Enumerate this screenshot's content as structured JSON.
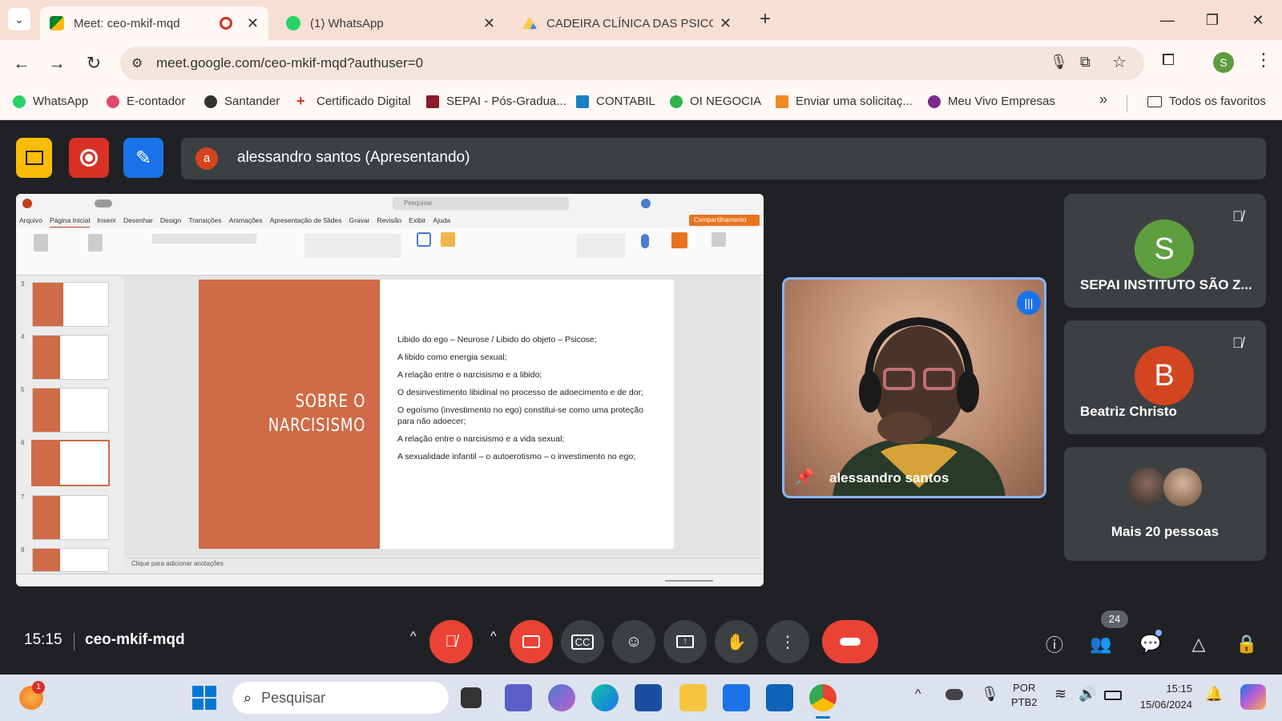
{
  "browser": {
    "tabs": [
      {
        "title": "Meet: ceo-mkif-mqd",
        "active": true
      },
      {
        "title": "(1) WhatsApp",
        "active": false
      },
      {
        "title": "CADEIRA CLÍNICA DAS PSICOSES",
        "active": false
      }
    ],
    "new_tab": "+",
    "url": "meet.google.com/ceo-mkif-mqd?authuser=0",
    "profile_initial": "S",
    "bookmarks": [
      "WhatsApp",
      "E-contador",
      "Santander",
      "Certificado Digital",
      "SEPAI - Pós-Gradua...",
      "CONTABIL",
      "OI NEGOCIA",
      "Enviar uma solicitaç...",
      "Meu Vivo Empresas"
    ],
    "bookmarks_more": "»",
    "all_favorites": "Todos os favoritos"
  },
  "meet": {
    "presenter_initial": "a",
    "presenter_label": "alessandro santos (Apresentando)",
    "time": "15:15",
    "meeting_code": "ceo-mkif-mqd",
    "people_count": "24",
    "main_video_name": "alessandro santos",
    "participants": [
      {
        "initial": "S",
        "name": "SEPAI INSTITUTO SÃO Z...",
        "color": "#5f9e3e"
      },
      {
        "initial": "B",
        "name": "Beatriz Christo",
        "color": "#d2451e"
      }
    ],
    "more_people": "Mais 20 pessoas"
  },
  "ppt": {
    "menu": [
      "Arquivo",
      "Página Inicial",
      "Inserir",
      "Desenhar",
      "Design",
      "Transições",
      "Animações",
      "Apresentação de Slides",
      "Gravar",
      "Revisão",
      "Exibir",
      "Ajuda"
    ],
    "share_label": "Compartilhamento",
    "search_placeholder": "Pesquisar",
    "slide_title_line1": "SOBRE O",
    "slide_title_line2": "NARCISISMO",
    "bullets": [
      "Libido do ego – Neurose / Libido do objeto – Psicose;",
      "A libido como energia sexual;",
      "A relação entre o narcisismo e a libido;",
      "O desinvestimento libidinal no processo de adoecimento e de dor;",
      "O egoísmo (investimento no ego) constitui-se como uma proteção para não adoecer;",
      "A relação entre o narcisismo e a vida sexual;",
      "A sexualidade infantil – o autoerotismo – o investimento no ego;"
    ],
    "thumb_numbers": [
      "3",
      "4",
      "5",
      "6",
      "7",
      "8"
    ],
    "notes_placeholder": "Clique para adicionar anotações"
  },
  "taskbar": {
    "search_placeholder": "Pesquisar",
    "lang_line1": "POR",
    "lang_line2": "PTB2",
    "time": "15:15",
    "date": "15/06/2024",
    "notif_count": "1"
  }
}
